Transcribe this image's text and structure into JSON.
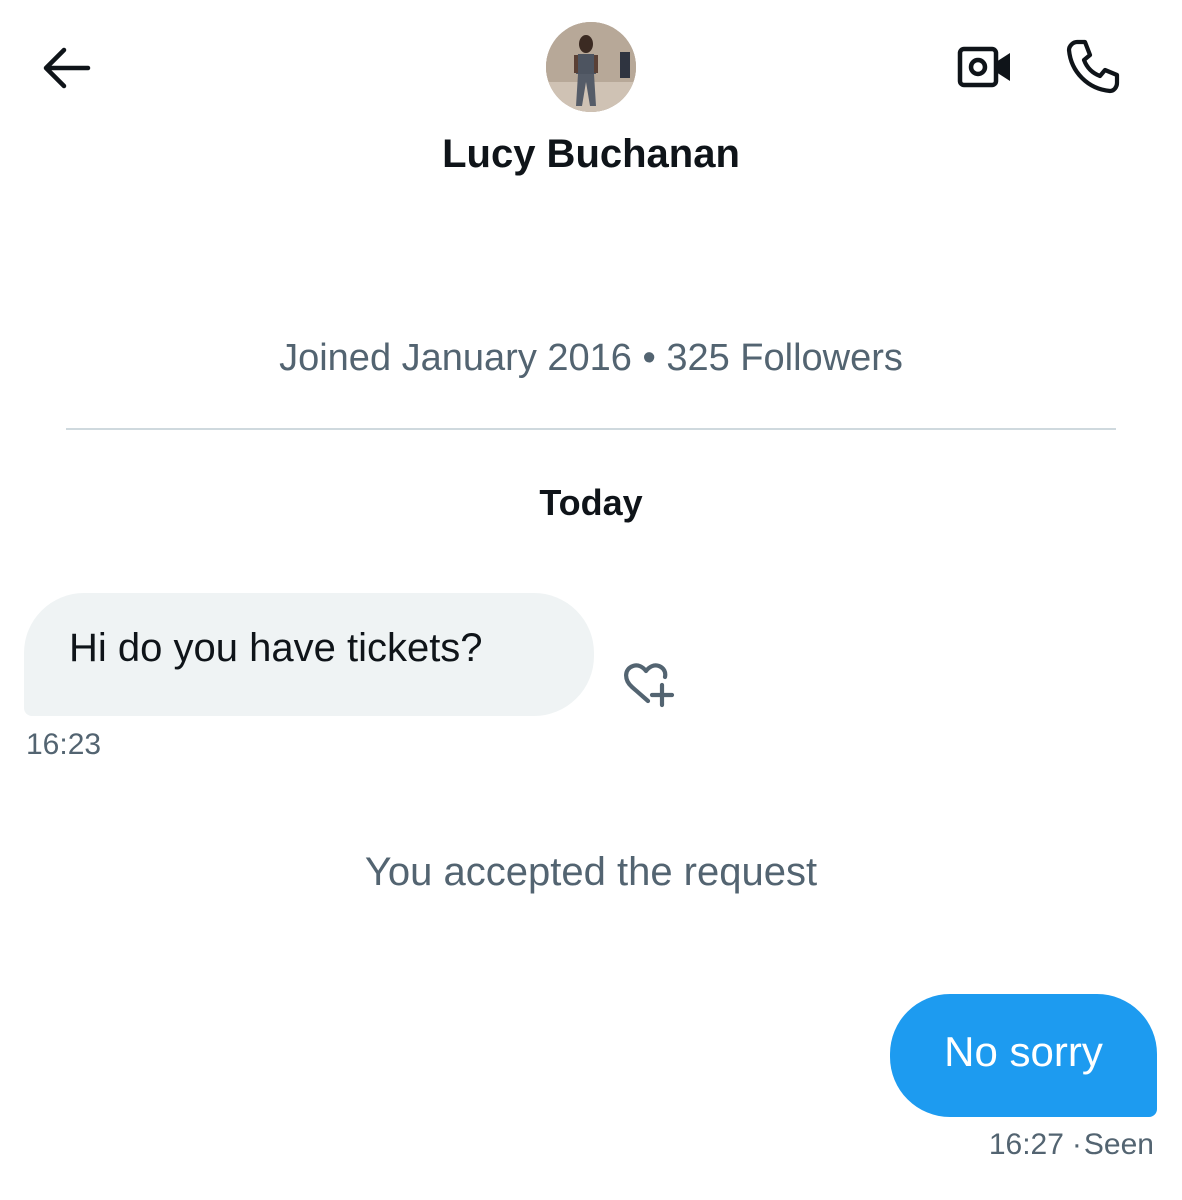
{
  "header": {
    "back_icon": "arrow-left-icon",
    "video_icon": "video-camera-icon",
    "call_icon": "phone-icon",
    "contact_name": "Lucy Buchanan"
  },
  "profile": {
    "meta": "Joined January 2016 • 325 Followers"
  },
  "conversation": {
    "date_label": "Today",
    "messages": [
      {
        "direction": "incoming",
        "text": "Hi do you have tickets?",
        "time": "16:23",
        "reaction_icon": "heart-plus-icon"
      },
      {
        "direction": "system",
        "text": "You accepted the request"
      },
      {
        "direction": "outgoing",
        "text": "No sorry",
        "time": "16:27",
        "separator": "·",
        "status": "Seen"
      }
    ]
  },
  "colors": {
    "outgoing_bubble": "#1d9bf0",
    "incoming_bubble": "#eff3f4",
    "secondary_text": "#536471",
    "primary_text": "#0f1419"
  }
}
